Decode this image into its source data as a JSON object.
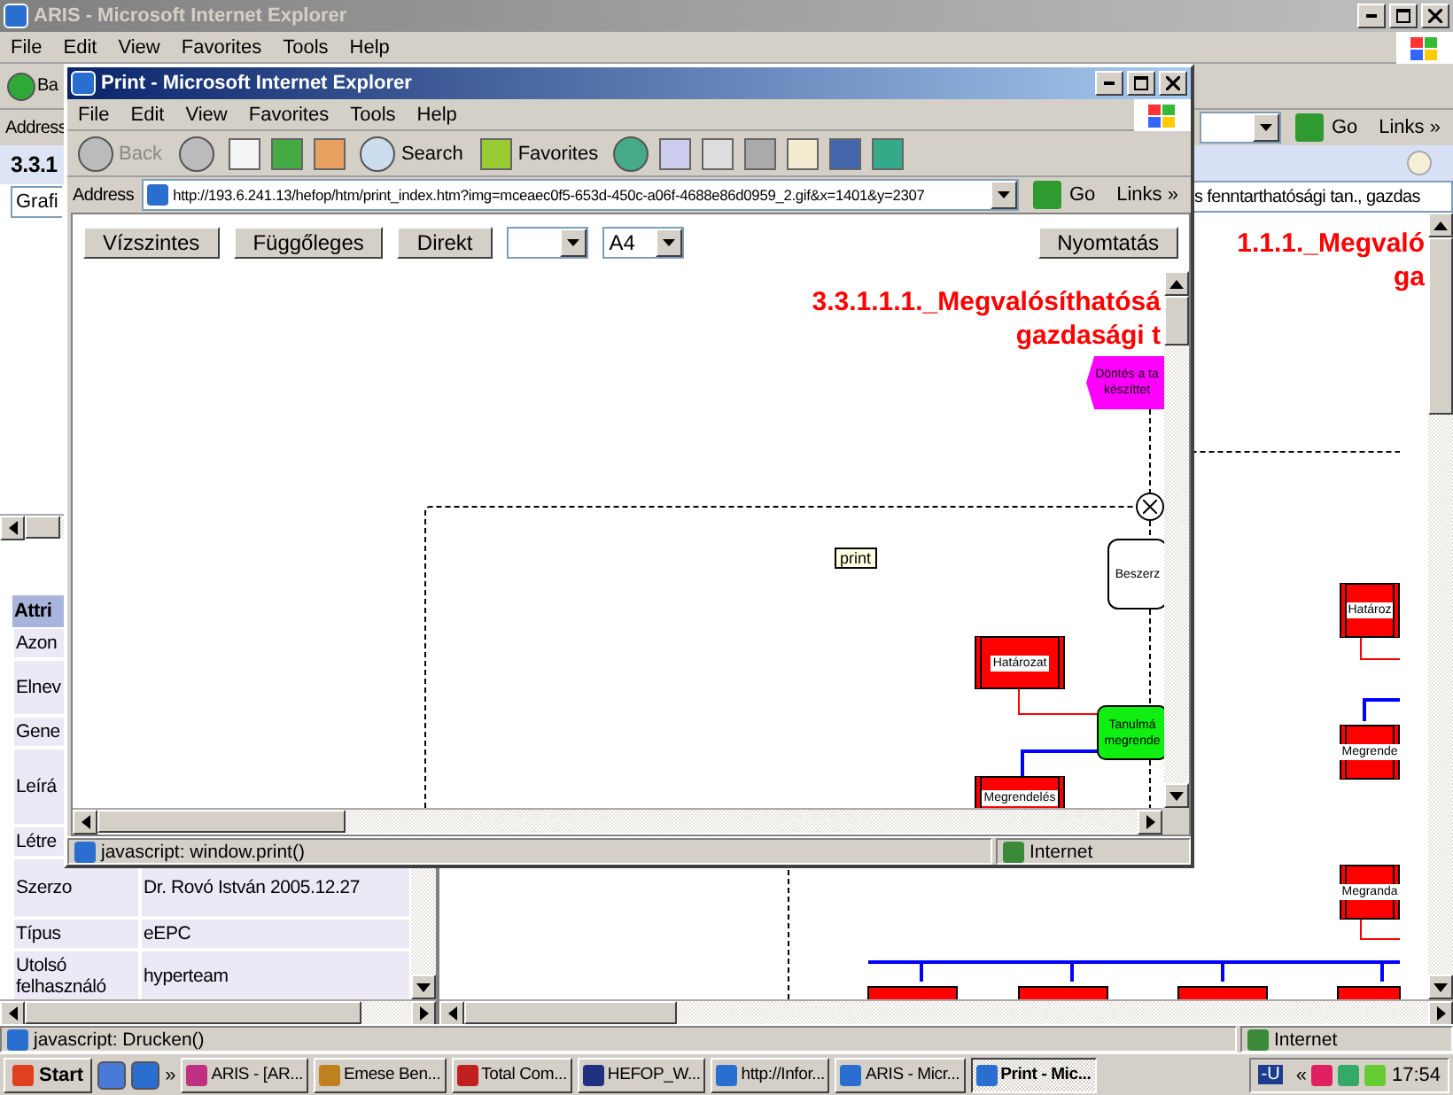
{
  "window": {
    "title": "ARIS - Microsoft Internet Explorer",
    "menu": [
      "File",
      "Edit",
      "View",
      "Favorites",
      "Tools",
      "Help"
    ],
    "back_label": "Ba",
    "address_label": "Address",
    "go": "Go",
    "links": "Links",
    "links_more": "»"
  },
  "left_panel": {
    "heading": "3.3.1",
    "view_select": "Grafi",
    "attributes": {
      "header": "Attri",
      "rows": [
        {
          "name": "Azon"
        },
        {
          "name": "Elnev"
        },
        {
          "name": "Gene"
        },
        {
          "name": "Leírá"
        },
        {
          "name": "Létre"
        },
        {
          "name": "Szerzo",
          "value": "Dr. Rovó István 2005.12.27"
        },
        {
          "name": "Típus",
          "value": "eEPC"
        },
        {
          "name": "Utolsó felhasználó",
          "value": "hyperteam"
        }
      ]
    }
  },
  "right_panel": {
    "model_select": "s fenntarthatósági tan., gazdas",
    "title_lines": [
      "1.1.1._Megvaló",
      "ga"
    ],
    "nodes": [
      {
        "kind": "information",
        "label": "Határoz"
      },
      {
        "kind": "information",
        "label": "Megrende"
      },
      {
        "kind": "information",
        "label": "Megranda"
      }
    ]
  },
  "status_bar": {
    "text": "javascript: Drucken()",
    "zone": "Internet"
  },
  "popup": {
    "title": "Print - Microsoft Internet Explorer",
    "menu": [
      "File",
      "Edit",
      "View",
      "Favorites",
      "Tools",
      "Help"
    ],
    "back": "Back",
    "search": "Search",
    "favorites": "Favorites",
    "address_label": "Address",
    "url": "http://193.6.241.13/hefop/htm/print_index.htm?img=mceaec0f5-653d-450c-a06f-4688e86d0959_2.gif&x=1401&y=2307",
    "go": "Go",
    "links": "Links",
    "links_more": "»",
    "buttons": [
      "Vízszintes",
      "Függőleges",
      "Direkt"
    ],
    "paper_select": "A4",
    "print_button": "Nyomtatás",
    "title_lines": [
      "3.3.1.1.1._Megvalósíthatósá",
      "gazdasági t"
    ],
    "tooltip": "print",
    "nodes": [
      {
        "kind": "event",
        "label": "Döntés a ta készíttet"
      },
      {
        "kind": "operator"
      },
      {
        "kind": "process",
        "label": "Beszerz"
      },
      {
        "kind": "information",
        "label": "Határozat"
      },
      {
        "kind": "function",
        "label": "Tanulmá megrende"
      },
      {
        "kind": "information",
        "label": "Megrendelés"
      }
    ],
    "status": "javascript: window.print()",
    "zone": "Internet"
  },
  "taskbar": {
    "start": "Start",
    "more": "»",
    "tasks": [
      {
        "label": "ARIS - [AR...",
        "selected": false
      },
      {
        "label": "Emese Ben...",
        "selected": false
      },
      {
        "label": "Total Com...",
        "selected": false
      },
      {
        "label": "HEFOP_W...",
        "selected": false
      },
      {
        "label": "http://Infor...",
        "selected": false
      },
      {
        "label": "ARIS - Micr...",
        "selected": false
      },
      {
        "label": "Print - Mic...",
        "selected": true
      }
    ],
    "tray_label": "-U",
    "tray_more": "«",
    "clock": "17:54"
  }
}
